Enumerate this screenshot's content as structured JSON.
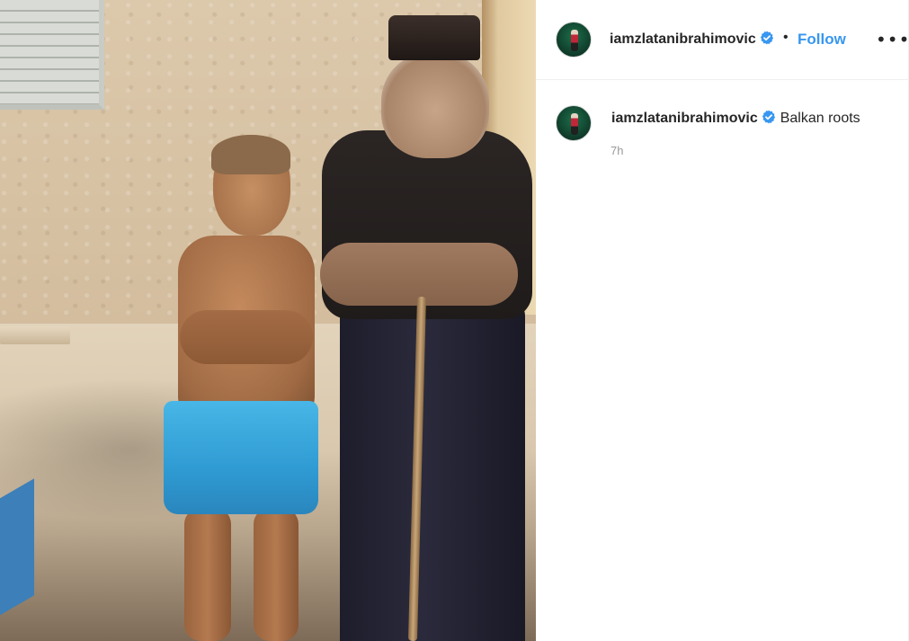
{
  "post": {
    "author": {
      "username": "iamzlatanibrahimovic",
      "verified_icon": "verified-badge-icon"
    },
    "header": {
      "separator": "•",
      "follow_label": "Follow",
      "more_label": "•••"
    },
    "caption": {
      "username": "iamzlatanibrahimovic",
      "text": "Balkan roots",
      "time": "7h"
    }
  },
  "colors": {
    "accent": "#3897f0",
    "verified": "#3897f0",
    "text": "#262626",
    "muted": "#999999"
  }
}
